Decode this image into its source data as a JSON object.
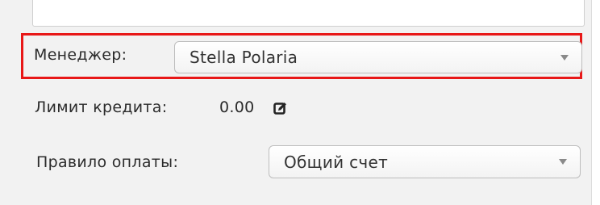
{
  "manager": {
    "label": "Менеджер:",
    "selected": "Stella Polaria"
  },
  "credit_limit": {
    "label": "Лимит кредита:",
    "value": "0.00"
  },
  "payment_rule": {
    "label": "Правило оплаты:",
    "selected": "Общий счет"
  },
  "colors": {
    "highlight": "#e81818",
    "panel_bg": "#f2f2f2"
  },
  "icons": {
    "edit": "edit-icon"
  }
}
